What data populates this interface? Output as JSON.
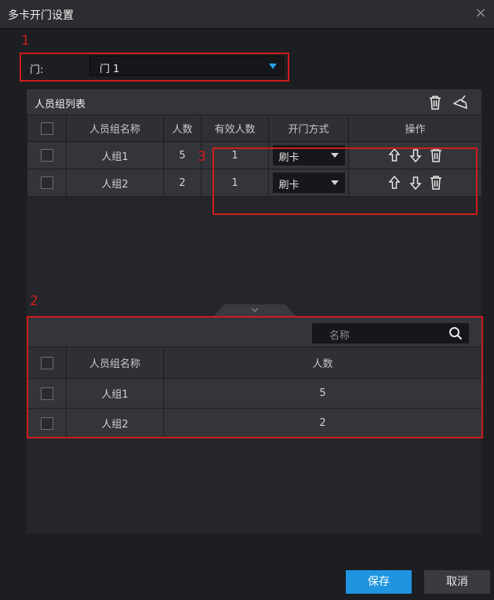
{
  "window": {
    "title": "多卡开门设置",
    "close_label": "×"
  },
  "door": {
    "label": "门:",
    "value": "门 1"
  },
  "group_list": {
    "title": "人员组列表",
    "columns": [
      "人员组名称",
      "人数",
      "有效人数",
      "开门方式",
      "操作"
    ],
    "rows": [
      {
        "name": "人组1",
        "count": "5",
        "valid": "1",
        "method": "刷卡"
      },
      {
        "name": "人组2",
        "count": "2",
        "valid": "1",
        "method": "刷卡"
      }
    ]
  },
  "search": {
    "placeholder": "名称"
  },
  "member_list": {
    "columns": [
      "人员组名称",
      "人数"
    ],
    "rows": [
      {
        "name": "人组1",
        "count": "5"
      },
      {
        "name": "人组2",
        "count": "2"
      }
    ]
  },
  "annotations": [
    "1",
    "2",
    "3"
  ],
  "footer": {
    "save_label": "保存",
    "cancel_label": "取消"
  },
  "colors": {
    "accent": "#1f95e0",
    "annotation": "#d01c1c",
    "dropdown_arrow": "#2aa1e9"
  }
}
